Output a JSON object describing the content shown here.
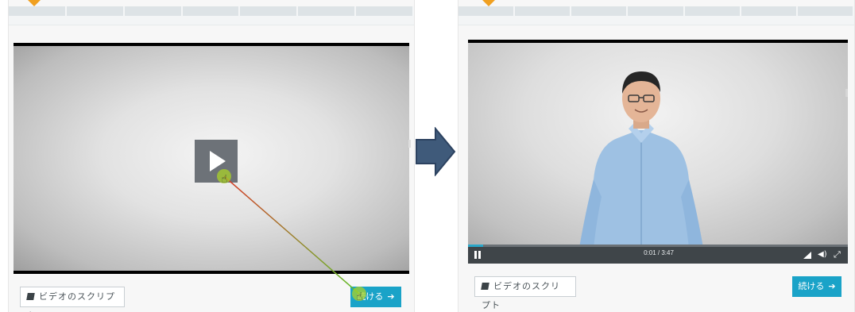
{
  "left_panel": {
    "script_button_label": "ビデオのスクリプト",
    "continue_button_label": "続ける",
    "continue_icon": "arrow-right-icon",
    "play_icon": "play-icon"
  },
  "right_panel": {
    "script_button_label": "ビデオのスクリプト",
    "continue_button_label": "続ける",
    "continue_icon": "arrow-right-icon",
    "timecode": "0:01 / 3:47",
    "playback_progress": 0.005,
    "icons": [
      "pause-icon",
      "quality-icon",
      "volume-icon",
      "fullscreen-icon"
    ]
  },
  "colors": {
    "accent": "#1aa3c8",
    "marker": "#f0a020",
    "control_bar": "#3f4549",
    "transition_arrow": "#3f5a7a"
  }
}
